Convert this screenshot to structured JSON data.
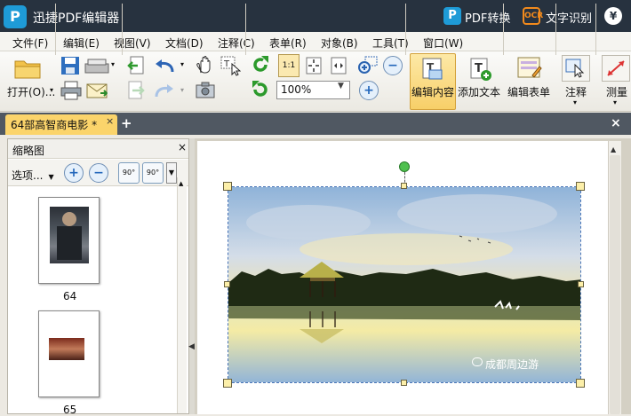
{
  "titlebar": {
    "logo": "P",
    "app_title": "迅捷PDF编辑器",
    "pdf_convert": "PDF转换",
    "ocr": "文字识别",
    "ocr_icon_text": "OCR",
    "yen": "¥"
  },
  "menu": [
    "文件(F)",
    "编辑(E)",
    "视图(V)",
    "文档(D)",
    "注释(C)",
    "表单(R)",
    "对象(B)",
    "工具(T)",
    "窗口(W)"
  ],
  "toolbar": {
    "open_label": "打开(O)...",
    "zoom_value": "100%",
    "edit_content_label": "编辑内容",
    "add_text_label": "添加文本",
    "edit_form_label": "编辑表单",
    "annotate_label": "注释",
    "measure_label": "测量",
    "fit_label": "1:1"
  },
  "tabs": {
    "doc_tab": "64部高智商电影 *",
    "close": "×",
    "add": "+",
    "win_close": "×"
  },
  "thumbnails": {
    "title": "缩略图",
    "close": "×",
    "options": "选项...",
    "rot_left": "90°",
    "rot_right": "90°",
    "pages": [
      {
        "number": "64"
      },
      {
        "number": "65"
      }
    ]
  },
  "document": {
    "watermark": "成都周边游"
  },
  "colors": {
    "titlebar": "#27323f",
    "accent_blue": "#1e9bd7",
    "ocr_orange": "#f28a1c",
    "tab_yellow": "#fbd46b",
    "active_button": "#f7cf68"
  }
}
